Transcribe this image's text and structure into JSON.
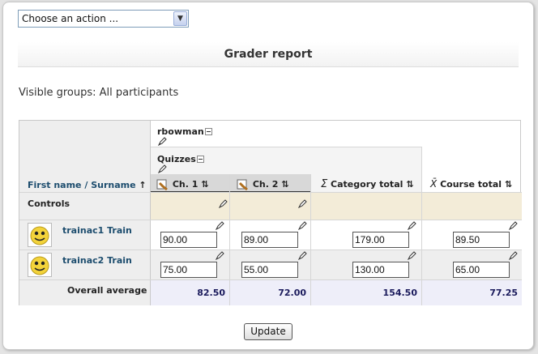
{
  "action_select": {
    "selected": "Choose an action ..."
  },
  "report_title": "Grader report",
  "visible_groups": "Visible groups: All participants",
  "header": {
    "name_col_first": "First name",
    "name_col_sep": " / ",
    "name_col_surname": "Surname",
    "name_sort_icon": "↑",
    "teacher": "rbowman",
    "category": "Quizzes",
    "col_ch1": "Ch. 1",
    "col_ch2": "Ch. 2",
    "col_category_total": "Category total",
    "col_course_total": "Course total",
    "sigma": "Σ",
    "xbar": "X̄",
    "sort_both": "⇅"
  },
  "controls_label": "Controls",
  "students": [
    {
      "name": "trainac1 Train",
      "ch1": "90.00",
      "ch2": "89.00",
      "category_total": "179.00",
      "course_total": "89.50"
    },
    {
      "name": "trainac2 Train",
      "ch1": "75.00",
      "ch2": "55.00",
      "category_total": "130.00",
      "course_total": "65.00"
    }
  ],
  "overall_average": {
    "label": "Overall average",
    "ch1": "82.50",
    "ch2": "72.00",
    "category_total": "154.50",
    "course_total": "77.25"
  },
  "update_label": "Update",
  "icons": {
    "edit": "pencil-edit-icon",
    "toggle": "collapse-toggle-icon",
    "avatar": "smiley-avatar-icon",
    "quiz": "quiz-item-icon"
  }
}
